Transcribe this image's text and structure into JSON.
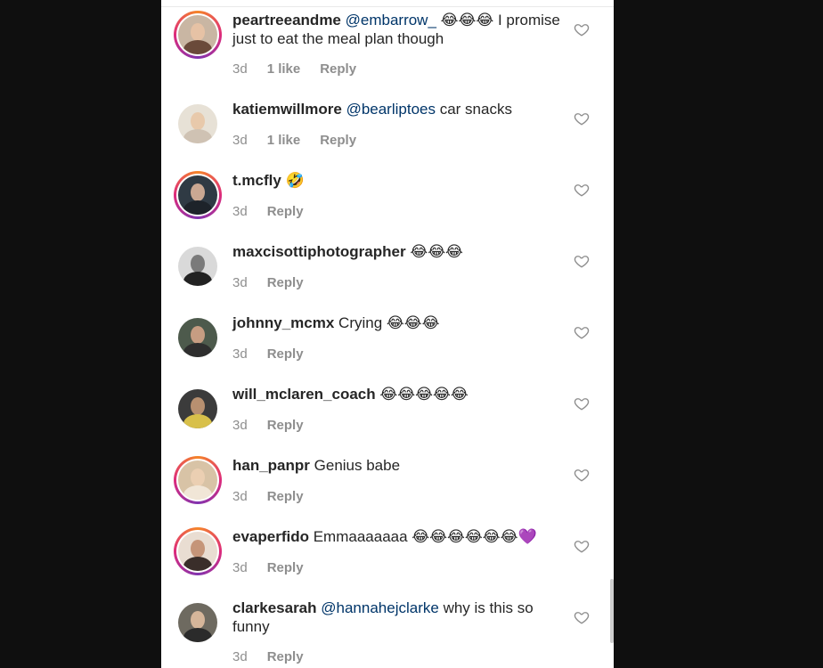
{
  "comments": [
    {
      "username": "peartreeandme",
      "mention": "@embarrow_",
      "text": " 😂😂😂 I promise just to eat the meal plan though",
      "time": "3d",
      "likes": "1 like",
      "reply": "Reply",
      "story_ring": true,
      "avatar_bg": "#c9b6a3",
      "avatar_face": "#e6c2a5",
      "avatar_body": "#6a4a3a"
    },
    {
      "username": "katiemwillmore",
      "mention": "@bearliptoes",
      "text": " car snacks",
      "time": "3d",
      "likes": "1 like",
      "reply": "Reply",
      "story_ring": false,
      "avatar_bg": "#e7e1d6",
      "avatar_face": "#e8c9ab",
      "avatar_body": "#cfc2b3"
    },
    {
      "username": "t.mcfly",
      "mention": "",
      "text": " 🤣",
      "time": "3d",
      "likes": "",
      "reply": "Reply",
      "story_ring": true,
      "avatar_bg": "#2f3a44",
      "avatar_face": "#caa893",
      "avatar_body": "#1d232a"
    },
    {
      "username": "maxcisottiphotographer",
      "mention": "",
      "text": " 😂😂😂",
      "time": "3d",
      "likes": "",
      "reply": "Reply",
      "story_ring": false,
      "avatar_bg": "#d9d9d9",
      "avatar_face": "#7a7a7a",
      "avatar_body": "#222222"
    },
    {
      "username": "johnny_mcmx",
      "mention": "",
      "text": " Crying 😂😂😂",
      "time": "3d",
      "likes": "",
      "reply": "Reply",
      "story_ring": false,
      "avatar_bg": "#4d5a4c",
      "avatar_face": "#c79d82",
      "avatar_body": "#2e2e2e"
    },
    {
      "username": "will_mclaren_coach",
      "mention": "",
      "text": " 😂😂😂😂😂",
      "time": "3d",
      "likes": "",
      "reply": "Reply",
      "story_ring": false,
      "avatar_bg": "#3b3b3b",
      "avatar_face": "#b89070",
      "avatar_body": "#d8c04a"
    },
    {
      "username": "han_panpr",
      "mention": "",
      "text": " Genius babe",
      "time": "3d",
      "likes": "",
      "reply": "Reply",
      "story_ring": true,
      "avatar_bg": "#d8c3a6",
      "avatar_face": "#ebcfb2",
      "avatar_body": "#f1e6d7"
    },
    {
      "username": "evaperfido",
      "mention": "",
      "text": " Emmaaaaaaa 😂😂😂😂😂😂💜",
      "time": "3d",
      "likes": "",
      "reply": "Reply",
      "story_ring": true,
      "avatar_bg": "#e9ddd2",
      "avatar_face": "#c59579",
      "avatar_body": "#3a2e2a"
    },
    {
      "username": "clarkesarah",
      "mention": "@hannahejclarke",
      "text": " why is this so funny",
      "time": "3d",
      "likes": "",
      "reply": "Reply",
      "story_ring": false,
      "avatar_bg": "#6e6a60",
      "avatar_face": "#d6b69a",
      "avatar_body": "#2b2b2b"
    }
  ]
}
